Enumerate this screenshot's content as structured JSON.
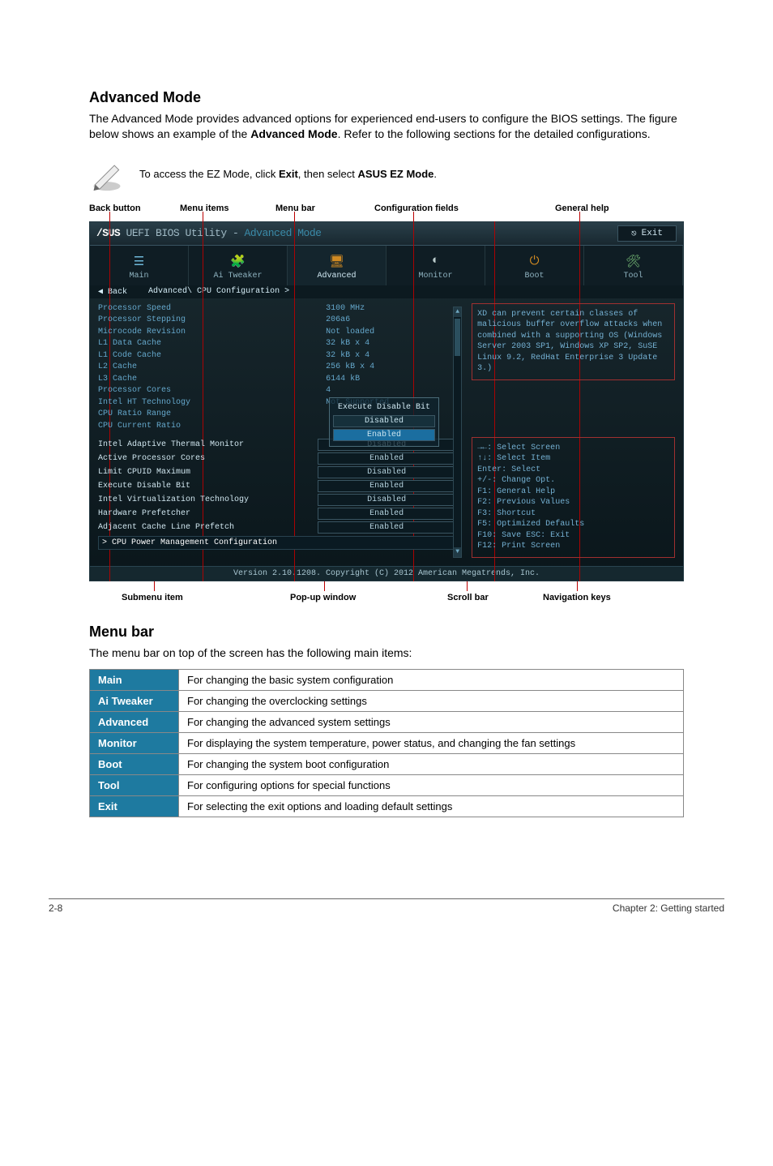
{
  "section1": {
    "title": "Advanced Mode",
    "para": "The Advanced Mode provides advanced options for experienced end-users to configure the BIOS settings. The figure below shows an example of the ",
    "para_bold": "Advanced Mode",
    "para_tail": ". Refer to the following sections for the detailed configurations."
  },
  "note": {
    "text_pre": "To access the EZ Mode, click ",
    "b1": "Exit",
    "mid": ", then select ",
    "b2": "ASUS EZ Mode",
    "tail": "."
  },
  "top_annotations": {
    "back_button": "Back button",
    "menu_items": "Menu items",
    "menu_bar": "Menu bar",
    "config_fields": "Configuration fields",
    "general_help": "General help"
  },
  "bottom_annotations": {
    "submenu_item": "Submenu item",
    "popup_window": "Pop-up window",
    "scroll_bar": "Scroll bar",
    "nav_keys": "Navigation keys"
  },
  "bios": {
    "logo_brand": "/SUS",
    "logo_rest1": " UEFI BIOS Utility - ",
    "logo_rest2": "Advanced Mode",
    "exit_label": "Exit",
    "tabs": {
      "main": "Main",
      "ai_tweaker": "Ai Tweaker",
      "advanced": "Advanced",
      "monitor": "Monitor",
      "boot": "Boot",
      "tool": "Tool"
    },
    "back_label": "Back",
    "breadcrumb": "Advanced\\ CPU Configuration >",
    "static_info": [
      {
        "label": "Processor Speed",
        "value": "3100 MHz"
      },
      {
        "label": "Processor Stepping",
        "value": "206a6"
      },
      {
        "label": "Microcode Revision",
        "value": "Not loaded"
      },
      {
        "label": "L1 Data Cache",
        "value": "32 kB x 4"
      },
      {
        "label": "L1 Code Cache",
        "value": "32 kB x 4"
      },
      {
        "label": "L2 Cache",
        "value": "256 kB x 4"
      },
      {
        "label": "L3 Cache",
        "value": "6144 kB"
      },
      {
        "label": "Processor Cores",
        "value": "4"
      },
      {
        "label": "Intel HT Technology",
        "value": "Not Supported"
      },
      {
        "label": "CPU Ratio Range",
        "value": ""
      },
      {
        "label": "CPU Current Ratio",
        "value": ""
      }
    ],
    "config_rows": [
      {
        "label": "Intel Adaptive Thermal Monitor",
        "value": "Disabled"
      },
      {
        "label": "Active Processor Cores",
        "value": "Enabled"
      },
      {
        "label": "Limit CPUID Maximum",
        "value": "Disabled"
      },
      {
        "label": "Execute Disable Bit",
        "value": "Enabled"
      },
      {
        "label": "Intel Virtualization Technology",
        "value": "Disabled"
      },
      {
        "label": "Hardware Prefetcher",
        "value": "Enabled"
      },
      {
        "label": "Adjacent Cache Line Prefetch",
        "value": "Enabled"
      }
    ],
    "submenu": "> CPU Power Management Configuration",
    "popup_title": "Execute Disable Bit",
    "popup_items": [
      "Disabled",
      "Enabled"
    ],
    "popup_selected_index": 1,
    "help_text": "XD can prevent certain classes of malicious buffer overflow attacks when combined with a supporting OS (Windows Server 2003 SP1, Windows XP SP2, SuSE Linux 9.2, RedHat Enterprise 3 Update 3.)",
    "nav_keys": [
      "→←: Select Screen",
      "↑↓: Select Item",
      "Enter: Select",
      "+/-: Change Opt.",
      "F1: General Help",
      "F2: Previous Values",
      "F3: Shortcut",
      "F5: Optimized Defaults",
      "F10: Save  ESC: Exit",
      "F12: Print Screen"
    ],
    "footer": "Version 2.10.1208. Copyright (C) 2012 American Megatrends, Inc."
  },
  "menubar_section": {
    "title": "Menu bar",
    "intro": "The menu bar on top of the screen has the following main items:",
    "rows": [
      {
        "head": "Main",
        "desc": "For changing the basic system configuration"
      },
      {
        "head": "Ai Tweaker",
        "desc": "For changing the overclocking settings"
      },
      {
        "head": "Advanced",
        "desc": "For changing the advanced system settings"
      },
      {
        "head": "Monitor",
        "desc": "For displaying the system temperature, power status, and changing the fan settings"
      },
      {
        "head": "Boot",
        "desc": "For changing the system boot configuration"
      },
      {
        "head": "Tool",
        "desc": "For configuring options for special functions"
      },
      {
        "head": "Exit",
        "desc": "For selecting the exit options and loading default settings"
      }
    ]
  },
  "footer": {
    "left": "2-8",
    "right": "Chapter 2: Getting started"
  }
}
